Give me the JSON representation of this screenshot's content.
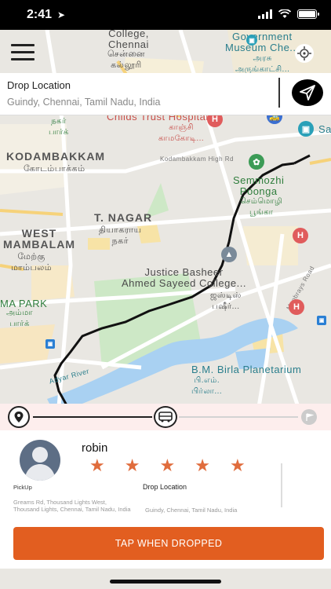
{
  "status": {
    "time": "2:41"
  },
  "map": {
    "labels": {
      "college": "College,\nChennai",
      "college_ta": "சென்னை\nகல்லூரி",
      "museum": "Government\nMuseum Che...",
      "museum_ta": "அரசு\nஅருங்காட்சி...",
      "childs_trust": "Childs Trust Hospital",
      "childs_trust_ta": "காஞ்சி\nகாமகோடி...",
      "nagar_ta": "நகர்\nபார்க்",
      "kodambakkam": "KODAMBAKKAM",
      "kodambakkam_ta": "கோடம்பாக்கம்",
      "kodambakkam_road": "Kodambakkam High Rd",
      "semmozhi": "Semmozhi\nPoonga",
      "semmozhi_ta": "செம்மொழி\nபூங்கா",
      "tnagar": "T. NAGAR",
      "tnagar_ta": "தியாகராய\nநகர்",
      "west_mambalam": "WEST\nMAMBALAM",
      "west_mambalam_ta": "மேற்கு\nமாம்பலம்",
      "justice": "Justice Basheer\nAhmed Sayeed College...",
      "justice_ta": "ஜஸ்டிஸ்\nபஷீர்...",
      "moobrays": "Moobrays Road",
      "park": "MA PARK",
      "park_ta": "அம்மா\nபார்க்",
      "planetarium": "B.M. Birla Planetarium",
      "planetarium_ta": "பி.எம்.\nபிர்லா...",
      "adyar": "Adyar River",
      "sa": "Sa"
    }
  },
  "drop": {
    "title": "Drop Location",
    "address": "Guindy, Chennai, Tamil Nadu, India"
  },
  "rider": {
    "name": "robin",
    "rating": 5,
    "pickup_label": "PickUp",
    "pickup_address": "Greams Rd, Thousand Lights West, Thousand Lights, Chennai, Tamil Nadu, India",
    "drop_label": "Drop Location",
    "drop_address": "Guindy, Chennai, Tamil Nadu, India"
  },
  "action": {
    "label": "TAP WHEN DROPPED"
  },
  "icons": {
    "menu": "menu-icon",
    "locate": "crosshair-icon",
    "send": "navigation-arrow-icon",
    "pickup": "location-pin-icon",
    "vehicle": "bus-icon",
    "destination": "flag-icon",
    "avatar": "user-avatar-icon"
  },
  "colors": {
    "accent": "#e25e20",
    "star": "#e06c3c",
    "route": "#111111"
  }
}
